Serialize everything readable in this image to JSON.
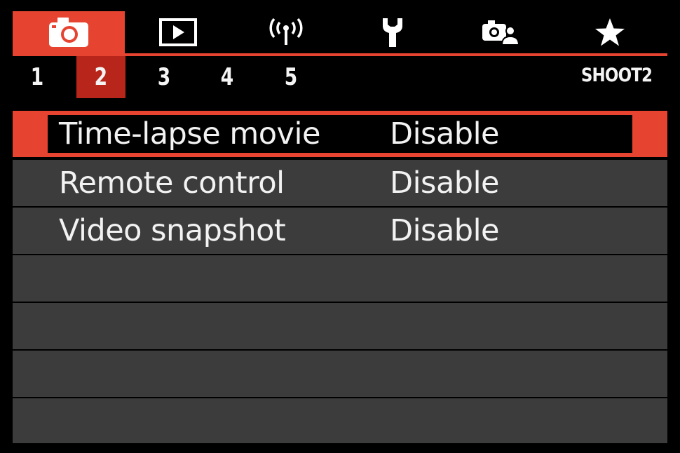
{
  "tabs": [
    {
      "icon": "camera-icon",
      "active": true
    },
    {
      "icon": "playback-icon",
      "active": false
    },
    {
      "icon": "wireless-icon",
      "active": false
    },
    {
      "icon": "wrench-icon",
      "active": false
    },
    {
      "icon": "custom-functions-icon",
      "active": false
    },
    {
      "icon": "star-icon",
      "active": false
    }
  ],
  "pages": [
    "1",
    "2",
    "3",
    "4",
    "5"
  ],
  "active_page": "2",
  "menu_code": "SHOOT2",
  "items": [
    {
      "label": "Time-lapse movie",
      "value": "Disable"
    },
    {
      "label": "Remote control",
      "value": "Disable"
    },
    {
      "label": "Video snapshot",
      "value": "Disable"
    }
  ],
  "colors": {
    "accent": "#e64431",
    "page_highlight": "#b8251b",
    "row_bg": "#3c3c3c",
    "background": "#000000",
    "text": "#f2f2f2"
  }
}
